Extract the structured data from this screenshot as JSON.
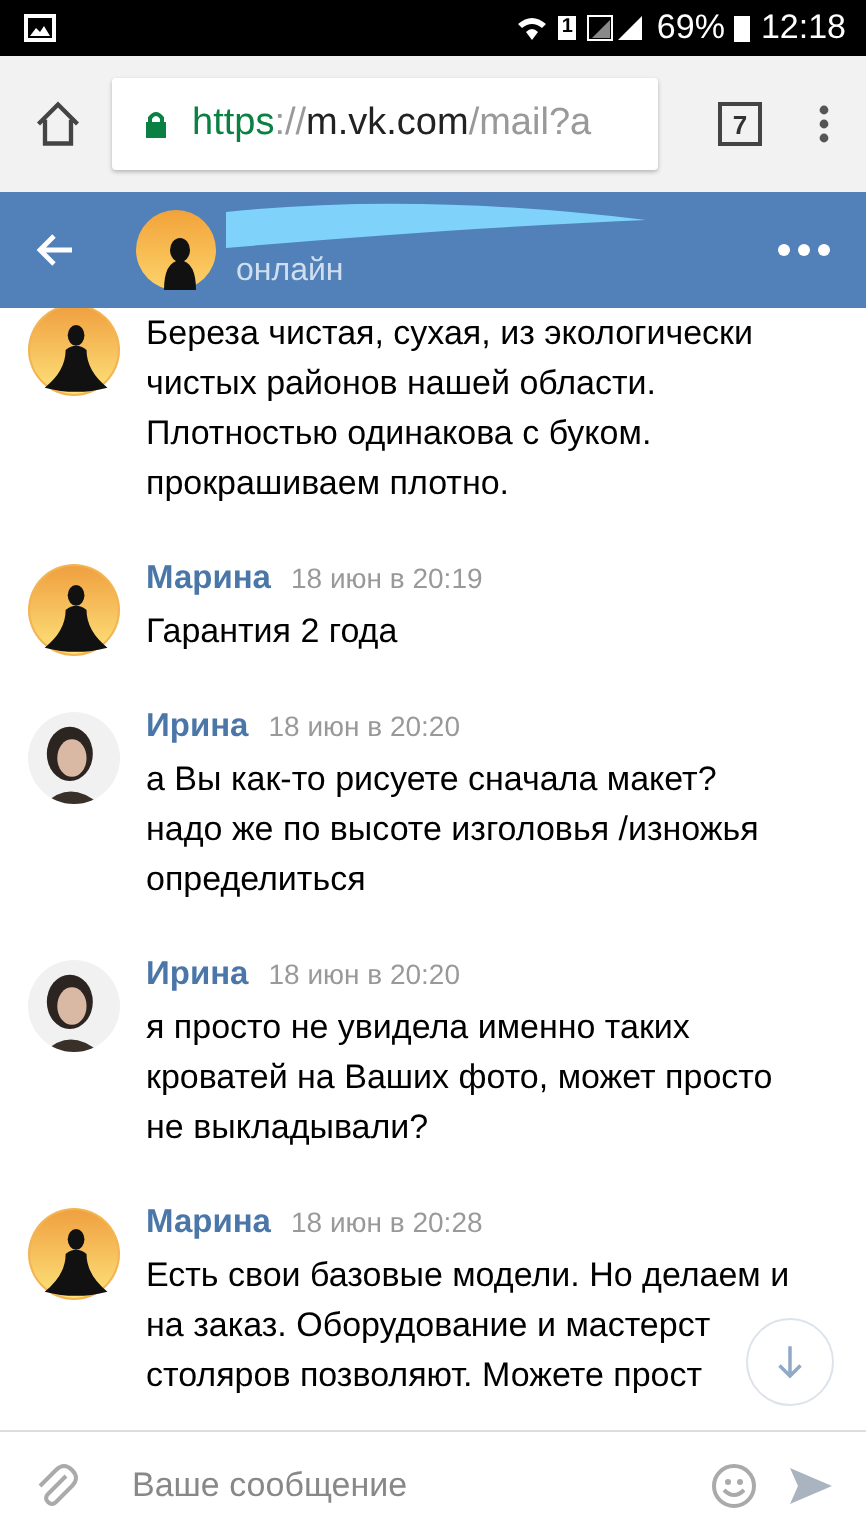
{
  "status_bar": {
    "battery": "69%",
    "time": "12:18",
    "sim": "1"
  },
  "browser": {
    "url_scheme": "https",
    "url_sep": "://",
    "url_host": "m.vk.com",
    "url_path": "/mail?a",
    "tab_count": "7"
  },
  "chat_header": {
    "status": "онлайн"
  },
  "messages": [
    {
      "kind": "sunset",
      "lines": [
        "Береза чистая, сухая, из экологически",
        "чистых районов нашей области.",
        "Плотностью одинакова с буком.",
        "прокрашиваем плотно."
      ]
    },
    {
      "author": "Марина",
      "time": "18 июн в 20:19",
      "kind": "sunset",
      "lines": [
        "Гарантия 2 года"
      ]
    },
    {
      "author": "Ирина",
      "time": "18 июн в 20:20",
      "kind": "portrait",
      "lines": [
        "а Вы как-то рисуете сначала макет?",
        "надо же по высоте изголовья /изножья",
        "определиться"
      ]
    },
    {
      "author": "Ирина",
      "time": "18 июн в 20:20",
      "kind": "portrait",
      "lines": [
        "я просто не увидела именно таких",
        "кроватей на Ваших фото, может просто",
        "не выкладывали?"
      ]
    },
    {
      "author": "Марина",
      "time": "18 июн в 20:28",
      "kind": "sunset",
      "lines": [
        "Есть свои базовые модели. Но делаем и",
        "на заказ. Оборудование и мастерст",
        "столяров позволяют. Можете прост"
      ]
    }
  ],
  "composer": {
    "placeholder": "Ваше сообщение"
  }
}
